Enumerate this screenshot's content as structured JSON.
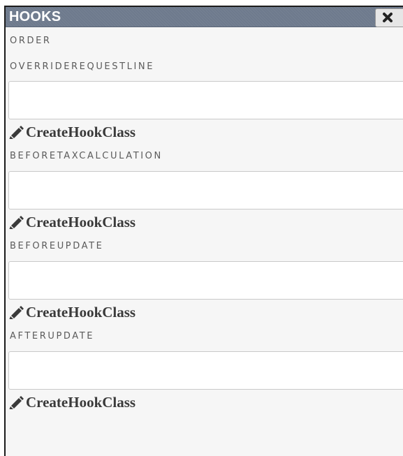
{
  "panel": {
    "title": "HOOKS",
    "close_icon": "close-icon"
  },
  "section": {
    "label": "ORDER"
  },
  "hooks": [
    {
      "label": "OVERRIDEREQUESTLINE",
      "value": "",
      "link_label": "CreateHookClass",
      "link_icon": "pencil-icon"
    },
    {
      "label": "BEFORETAXCALCULATION",
      "value": "",
      "link_label": "CreateHookClass",
      "link_icon": "pencil-icon"
    },
    {
      "label": "BEFOREUPDATE",
      "value": "",
      "link_label": "CreateHookClass",
      "link_icon": "pencil-icon"
    },
    {
      "label": "AFTERUPDATE",
      "value": "",
      "link_label": "CreateHookClass",
      "link_icon": "pencil-icon"
    }
  ],
  "colors": {
    "titlebar": "#6e7a8d",
    "panel_bg": "#f6f6f6",
    "label_text": "#5b5b5b",
    "link_text": "#3a3a3a"
  }
}
